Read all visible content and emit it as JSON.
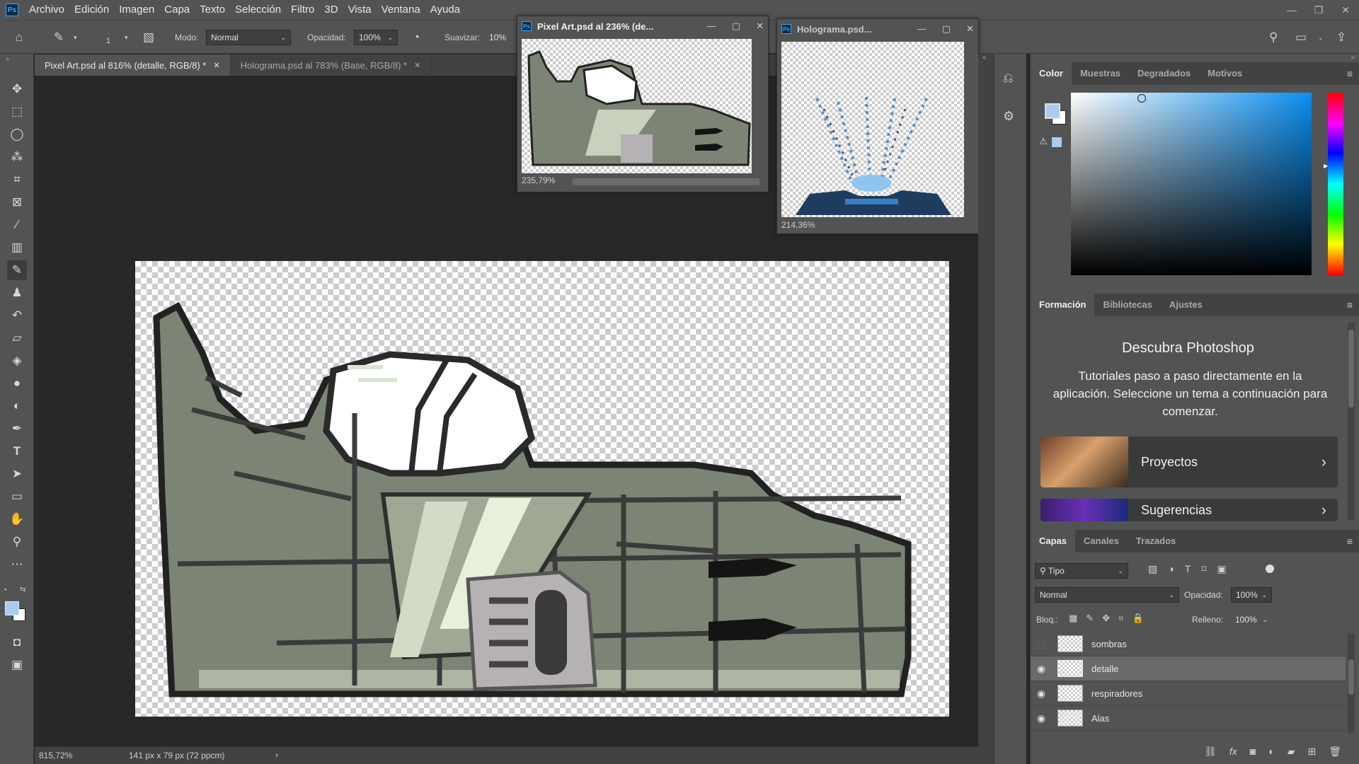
{
  "app": {
    "logo": "Ps"
  },
  "menu": [
    "Archivo",
    "Edición",
    "Imagen",
    "Capa",
    "Texto",
    "Selección",
    "Filtro",
    "3D",
    "Vista",
    "Ventana",
    "Ayuda"
  ],
  "options": {
    "brush_size": "1",
    "mode_label": "Modo:",
    "mode_value": "Normal",
    "opacity_label": "Opacidad:",
    "opacity_value": "100%",
    "smoothing_label": "Suavizar:",
    "smoothing_value": "10%"
  },
  "tabs": [
    {
      "label": "Pixel Art.psd al 816% (detalle, RGB/8) *",
      "active": true
    },
    {
      "label": "Holograma.psd al 783% (Base, RGB/8) *",
      "active": false
    }
  ],
  "float_windows": {
    "pixel_art": {
      "title": "Pixel Art.psd al 236% (de...",
      "zoom": "235,79%"
    },
    "holograma": {
      "title": "Holograma.psd...",
      "zoom": "214,36%"
    }
  },
  "status": {
    "zoom": "815,72%",
    "doc_size": "141 px x 79 px (72 ppcm)"
  },
  "color_panel": {
    "tabs": [
      "Color",
      "Muestras",
      "Degradados",
      "Motivos"
    ],
    "foreground": "#a8cbf0",
    "background": "#ffffff"
  },
  "learn_panel": {
    "tabs": [
      "Formación",
      "Bibliotecas",
      "Ajustes"
    ],
    "title": "Descubra Photoshop",
    "description": "Tutoriales paso a paso directamente en la aplicación. Seleccione un tema a continuación para comenzar.",
    "cards": [
      "Proyectos",
      "Sugerencias"
    ]
  },
  "layers_panel": {
    "tabs": [
      "Capas",
      "Canales",
      "Trazados"
    ],
    "filter_label": "Tipo",
    "blend_mode": "Normal",
    "opacity_label": "Opacidad:",
    "opacity_value": "100%",
    "lock_label": "Bloq.:",
    "fill_label": "Relleno:",
    "fill_value": "100%",
    "layers": [
      {
        "name": "sombras",
        "visible": false,
        "selected": false
      },
      {
        "name": "detalle",
        "visible": true,
        "selected": true
      },
      {
        "name": "respiradores",
        "visible": true,
        "selected": false
      },
      {
        "name": "Alas",
        "visible": true,
        "selected": false
      }
    ]
  }
}
